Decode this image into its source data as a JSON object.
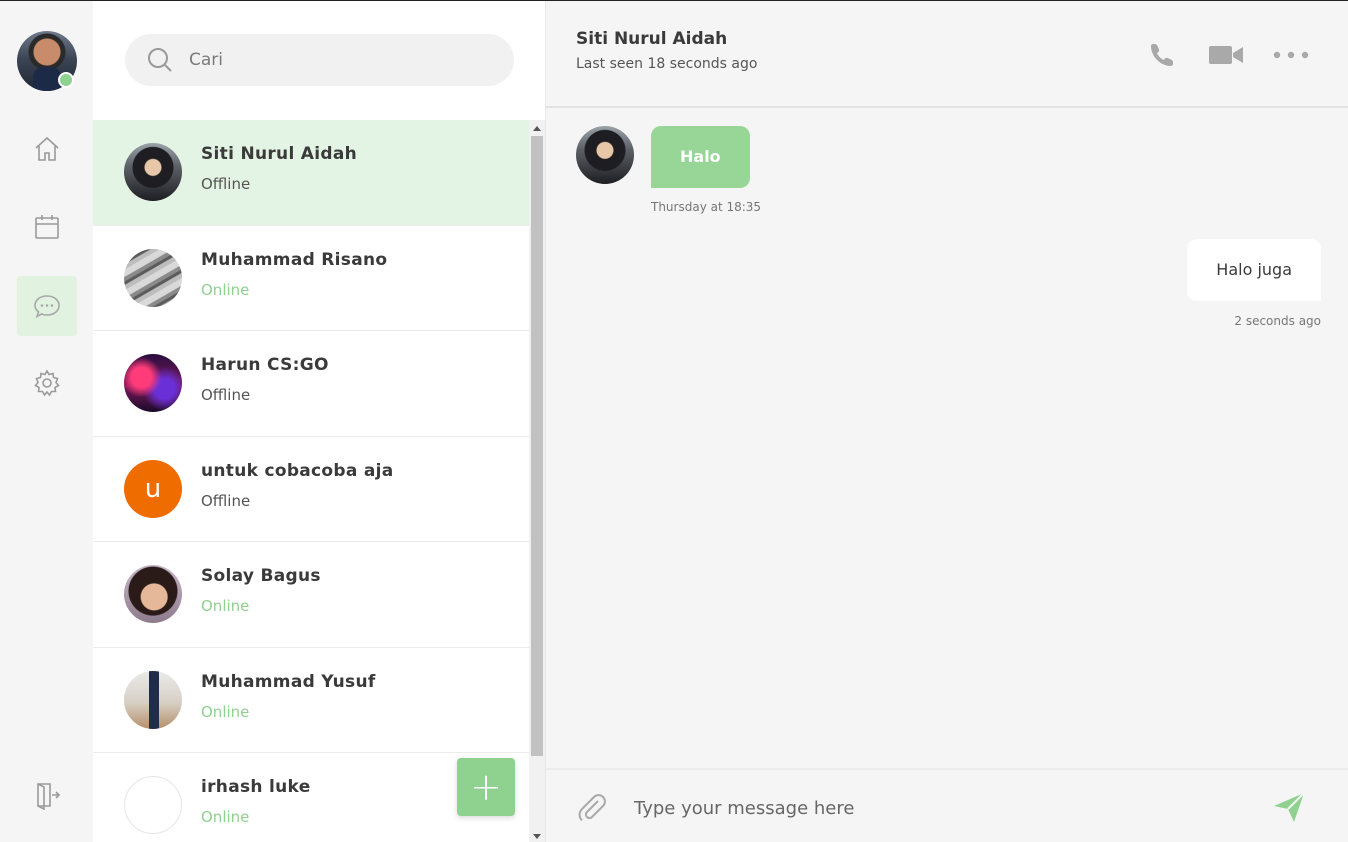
{
  "rail": {
    "items": [
      {
        "name": "home-icon"
      },
      {
        "name": "calendar-icon"
      },
      {
        "name": "chat-icon",
        "active": true
      },
      {
        "name": "gear-icon"
      },
      {
        "name": "logout-icon"
      }
    ]
  },
  "search": {
    "placeholder": "Cari"
  },
  "contacts": [
    {
      "name": "Siti Nurul Aidah",
      "status": "Offline",
      "online": false
    },
    {
      "name": "Muhammad Risano",
      "status": "Online",
      "online": true
    },
    {
      "name": "Harun CS:GO",
      "status": "Offline",
      "online": false
    },
    {
      "name": "untuk cobacoba aja",
      "status": "Offline",
      "online": false,
      "initial": "u"
    },
    {
      "name": "Solay Bagus",
      "status": "Online",
      "online": true
    },
    {
      "name": "Muhammad Yusuf",
      "status": "Online",
      "online": true
    },
    {
      "name": "irhash luke",
      "status": "Online",
      "online": true
    }
  ],
  "fab": {
    "label": "+"
  },
  "chat": {
    "title": "Siti Nurul Aidah",
    "subtitle": "Last seen 18 seconds ago",
    "messages": [
      {
        "direction": "in",
        "text": "Halo",
        "time": "Thursday at 18:35"
      },
      {
        "direction": "out",
        "text": "Halo juga",
        "time": "2 seconds ago"
      }
    ],
    "composer_placeholder": "Type your message here"
  },
  "colors": {
    "accent": "#8fd18f",
    "active_row": "#e4f4e4",
    "rail_bg": "#f5f5f5",
    "chat_bg": "#f5f5f5",
    "orange_avatar": "#ef6c00"
  }
}
